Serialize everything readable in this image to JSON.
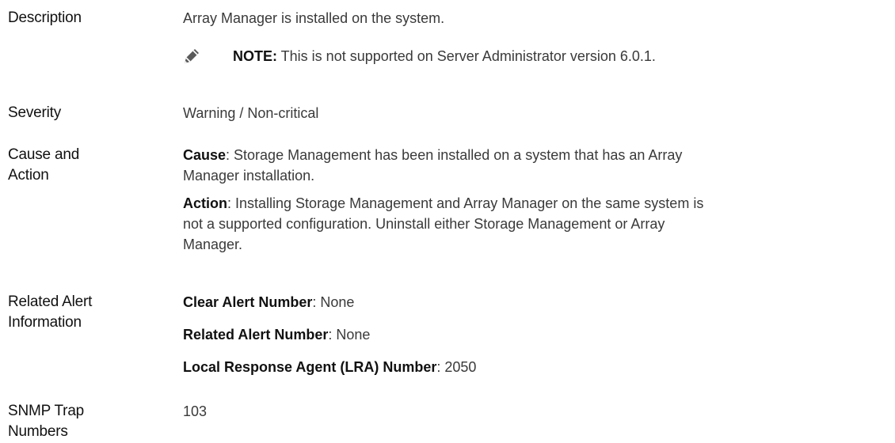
{
  "rows": {
    "description": {
      "label": "Description",
      "text": "Array Manager is installed on the system.",
      "note_label": "NOTE:",
      "note_text": " This is not supported on Server Administrator version 6.0.1.",
      "note_icon": "pencil-note-icon"
    },
    "severity": {
      "label": "Severity",
      "text": "Warning / Non-critical"
    },
    "cause_action": {
      "label_line1": "Cause and",
      "label_line2": "Action",
      "cause_term": "Cause",
      "cause_text": ": Storage Management has been installed on a system that has an Array",
      "cause_text2": "Manager installation.",
      "action_term": "Action",
      "action_text": ": Installing Storage Management and Array Manager on the same system is",
      "action_text2": "not a supported configuration. Uninstall either Storage Management or Array",
      "action_text3": "Manager."
    },
    "related_alert": {
      "label_line1": "Related Alert",
      "label_line2": "Information",
      "clear_term": "Clear Alert Number",
      "clear_value": ": None",
      "related_term": "Related Alert Number",
      "related_value": ": None",
      "lra_term": "Local Response Agent (LRA) Number",
      "lra_value": ": 2050"
    },
    "snmp": {
      "label_line1": "SNMP Trap",
      "label_line2": "Numbers",
      "text": "103"
    }
  }
}
